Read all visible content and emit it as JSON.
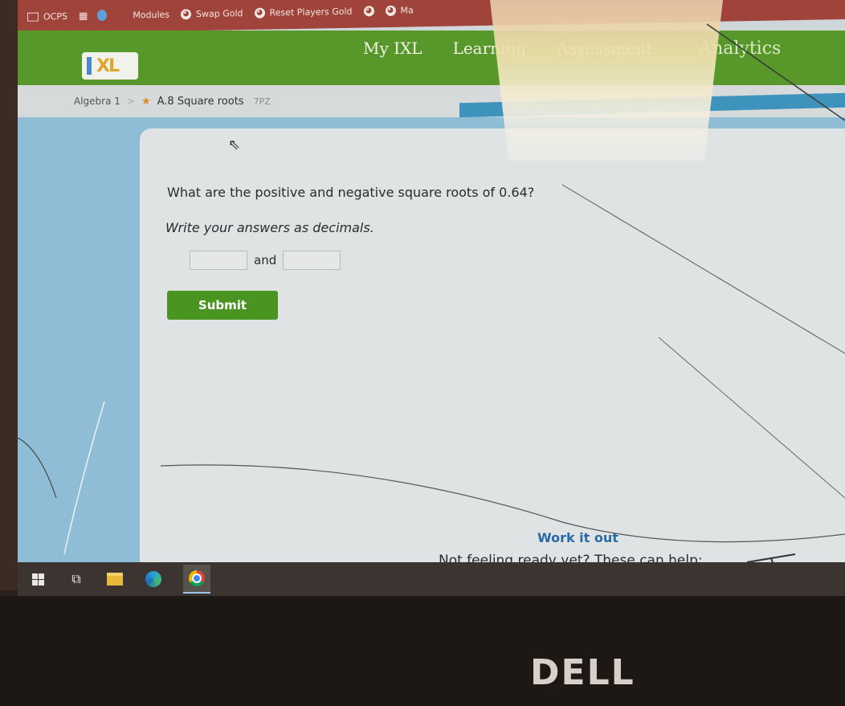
{
  "bookmarks": [
    {
      "label": "OCPS",
      "icon": "folder-icon"
    },
    {
      "label": "",
      "icon": "apps-grid-icon"
    },
    {
      "label": "",
      "icon": "blue-circle-icon"
    },
    {
      "label": "Modules",
      "icon": ""
    },
    {
      "label": "Swap Gold",
      "icon": "globe-icon"
    },
    {
      "label": "Reset Players Gold",
      "icon": "globe-icon"
    },
    {
      "label": "",
      "icon": "globe-icon"
    },
    {
      "label": "Ma",
      "icon": "globe-icon"
    }
  ],
  "nav": {
    "logo": "IXL",
    "links": [
      "My IXL",
      "Learning",
      "Assessment",
      "Analytics"
    ]
  },
  "breadcrumb": {
    "subject": "Algebra 1",
    "separator": ">",
    "skill": "A.8 Square roots",
    "code": "7PZ"
  },
  "question": {
    "prompt": "What are the positive and negative square roots of 0.64?",
    "instruction": "Write your answers as decimals.",
    "answer1_value": "",
    "conjunction": "and",
    "answer2_value": "",
    "submit_label": "Submit"
  },
  "help": {
    "title": "Work it out",
    "subtitle": "Not feeling ready yet? These can help:"
  },
  "taskbar": {
    "items": [
      "windows-start-icon",
      "task-view-icon",
      "file-explorer-icon",
      "edge-icon",
      "chrome-icon"
    ]
  },
  "device": {
    "brand": "DELL"
  },
  "colors": {
    "bookmarks_bg": "#a0433a",
    "nav_bg": "#58982a",
    "submit_bg": "#4a9522",
    "link_blue": "#2a6aa8",
    "band_blue": "#8fbdd5"
  }
}
